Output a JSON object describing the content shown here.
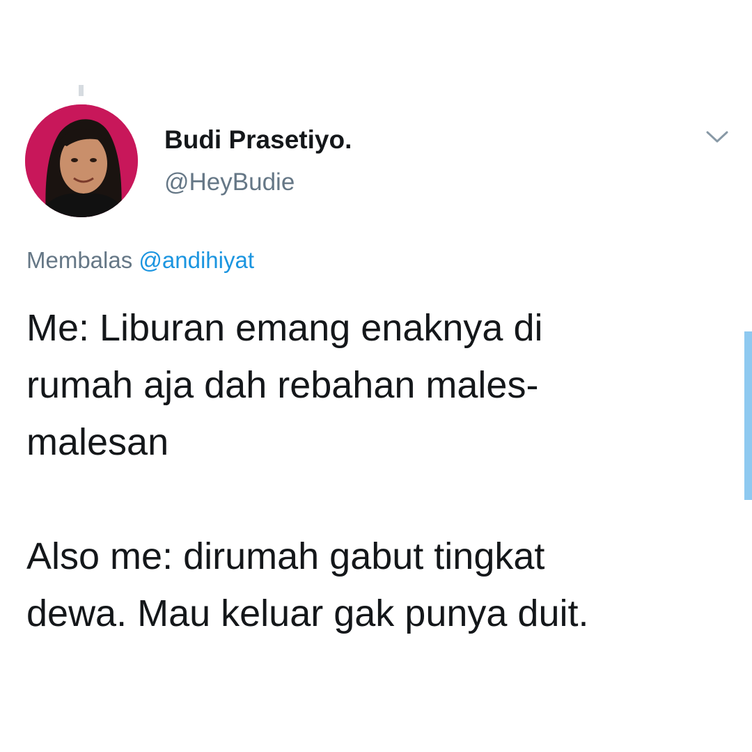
{
  "user": {
    "display_name": "Budi Prasetiyo.",
    "handle": "@HeyBudie"
  },
  "reply": {
    "prefix": "Membalas",
    "mention": "@andihiyat"
  },
  "tweet": {
    "line1": "Me: Liburan emang enaknya di",
    "line2": "rumah aja dah rebahan males-",
    "line3": "malesan",
    "line4": "Also me: dirumah gabut tingkat",
    "line5": "dewa. Mau keluar gak punya duit."
  },
  "icons": {
    "menu": "chevron-down-icon",
    "avatar": "profile-photo"
  },
  "colors": {
    "text": "#14171a",
    "secondary": "#657786",
    "link": "#1b95e0",
    "scrollbar": "#8ec9f0"
  }
}
